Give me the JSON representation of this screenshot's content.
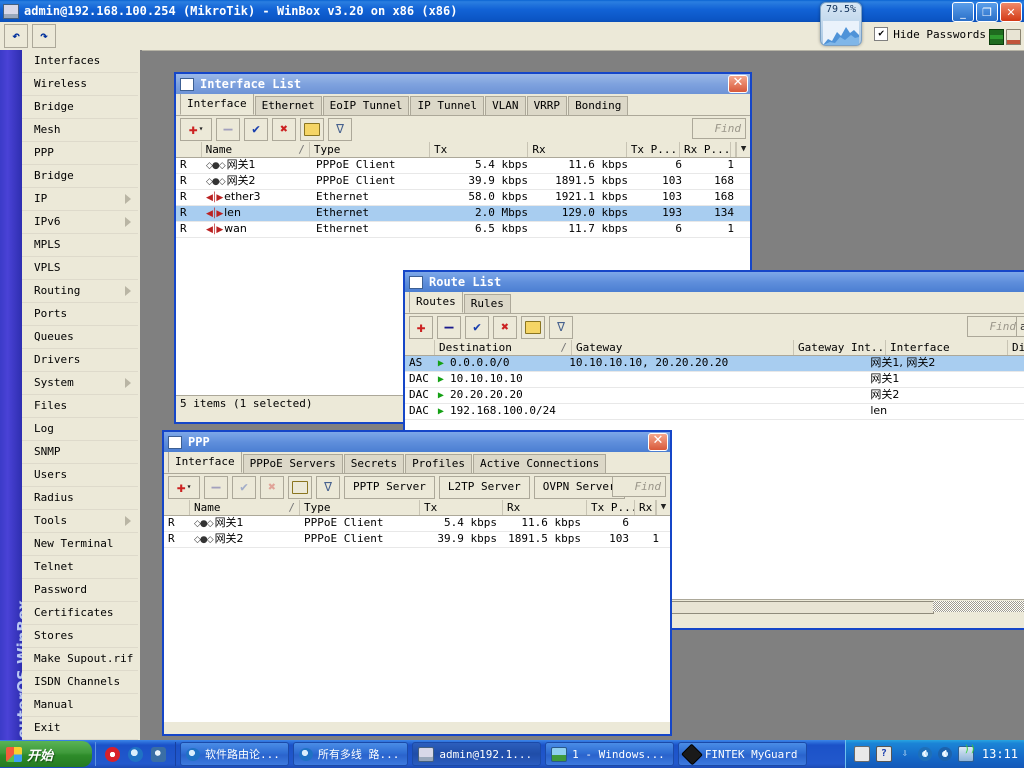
{
  "app": {
    "title": "admin@192.168.100.254 (MikroTik) - WinBox v3.20 on x86 (x86)",
    "title_icon": "window-icon",
    "minimize_label": "_",
    "maximize_label": "❐",
    "close_label": "✕",
    "toolbar": {
      "undo_icon": "↶",
      "redo_icon": "↷",
      "hide_passwords_label": "Hide Passwords",
      "hide_passwords_checked": "✔",
      "cpu_percent": "79.5%"
    }
  },
  "sidebar": {
    "rail_label": "RouterOS WinBox",
    "items": [
      {
        "label": "Interfaces",
        "submenu": false
      },
      {
        "label": "Wireless",
        "submenu": false
      },
      {
        "label": "Bridge",
        "submenu": false
      },
      {
        "label": "Mesh",
        "submenu": false
      },
      {
        "label": "PPP",
        "submenu": false
      },
      {
        "label": "Bridge",
        "submenu": false
      },
      {
        "label": "IP",
        "submenu": true
      },
      {
        "label": "IPv6",
        "submenu": true
      },
      {
        "label": "MPLS",
        "submenu": false
      },
      {
        "label": "VPLS",
        "submenu": false
      },
      {
        "label": "Routing",
        "submenu": true
      },
      {
        "label": "Ports",
        "submenu": false
      },
      {
        "label": "Queues",
        "submenu": false
      },
      {
        "label": "Drivers",
        "submenu": false
      },
      {
        "label": "System",
        "submenu": true
      },
      {
        "label": "Files",
        "submenu": false
      },
      {
        "label": "Log",
        "submenu": false
      },
      {
        "label": "SNMP",
        "submenu": false
      },
      {
        "label": "Users",
        "submenu": false
      },
      {
        "label": "Radius",
        "submenu": false
      },
      {
        "label": "Tools",
        "submenu": true
      },
      {
        "label": "New Terminal",
        "submenu": false
      },
      {
        "label": "Telnet",
        "submenu": false
      },
      {
        "label": "Password",
        "submenu": false
      },
      {
        "label": "Certificates",
        "submenu": false
      },
      {
        "label": "Stores",
        "submenu": false
      },
      {
        "label": "Make Supout.rif",
        "submenu": false
      },
      {
        "label": "ISDN Channels",
        "submenu": false
      },
      {
        "label": "Manual",
        "submenu": false
      },
      {
        "label": "Exit",
        "submenu": false
      }
    ]
  },
  "interface_window": {
    "title": "Interface List",
    "close_label": "✕",
    "tabs": [
      "Interface",
      "Ethernet",
      "EoIP Tunnel",
      "IP Tunnel",
      "VLAN",
      "VRRP",
      "Bonding"
    ],
    "active_tab": "Interface",
    "toolbar": {
      "add_label": "✚",
      "add_arrow": "▾",
      "remove_label": "—",
      "enable_label": "✔",
      "disable_label": "✖",
      "comment_label": "folder-icon",
      "filter_label": "∇",
      "find_placeholder": "Find"
    },
    "columns": [
      "",
      "Name",
      "Type",
      "Tx",
      "Rx",
      "Tx P...",
      "Rx P..."
    ],
    "sort_column": "Name",
    "rows": [
      {
        "flags": "R",
        "icon": "pppoe",
        "name": "网关1",
        "type": "PPPoE Client",
        "tx": "5.4 kbps",
        "rx": "11.6 kbps",
        "txp": "6",
        "rxp": "1",
        "selected": false
      },
      {
        "flags": "R",
        "icon": "pppoe",
        "name": "网关2",
        "type": "PPPoE Client",
        "tx": "39.9 kbps",
        "rx": "1891.5 kbps",
        "txp": "103",
        "rxp": "168",
        "selected": false
      },
      {
        "flags": "R",
        "icon": "eth",
        "name": "ether3",
        "type": "Ethernet",
        "tx": "58.0 kbps",
        "rx": "1921.1 kbps",
        "txp": "103",
        "rxp": "168",
        "selected": false
      },
      {
        "flags": "R",
        "icon": "eth",
        "name": "len",
        "type": "Ethernet",
        "tx": "2.0 Mbps",
        "rx": "129.0 kbps",
        "txp": "193",
        "rxp": "134",
        "selected": true
      },
      {
        "flags": "R",
        "icon": "eth",
        "name": "wan",
        "type": "Ethernet",
        "tx": "6.5 kbps",
        "rx": "11.7 kbps",
        "txp": "6",
        "rxp": "1",
        "selected": false
      }
    ],
    "status": "5 items (1 selected)"
  },
  "route_window": {
    "title": "Route List",
    "tabs": [
      "Routes",
      "Rules"
    ],
    "active_tab": "Routes",
    "toolbar": {
      "add_label": "✚",
      "remove_label": "—",
      "enable_label": "✔",
      "disable_label": "✖",
      "comment_label": "folder-icon",
      "filter_label": "∇",
      "find_placeholder": "Find",
      "scope_label": "a"
    },
    "columns": [
      "",
      "Destination",
      "Gateway",
      "Gateway Int...",
      "Interface",
      "Dist"
    ],
    "sort_column": "Destination",
    "rows": [
      {
        "flags": "AS",
        "destination": "0.0.0.0/0",
        "gateway": "10.10.10.10, 20.20.20.20",
        "gateway_int": "",
        "interface": "网关1, 网关2",
        "dist": "",
        "selected": true
      },
      {
        "flags": "DAC",
        "destination": "10.10.10.10",
        "gateway": "",
        "gateway_int": "",
        "interface": "网关1",
        "dist": "",
        "selected": false
      },
      {
        "flags": "DAC",
        "destination": "20.20.20.20",
        "gateway": "",
        "gateway_int": "",
        "interface": "网关2",
        "dist": "",
        "selected": false
      },
      {
        "flags": "DAC",
        "destination": "192.168.100.0/24",
        "gateway": "",
        "gateway_int": "",
        "interface": "len",
        "dist": "",
        "selected": false
      }
    ]
  },
  "ppp_window": {
    "title": "PPP",
    "close_label": "✕",
    "tabs": [
      "Interface",
      "PPPoE Servers",
      "Secrets",
      "Profiles",
      "Active Connections"
    ],
    "active_tab": "Interface",
    "toolbar": {
      "add_label": "✚",
      "add_arrow": "▾",
      "remove_label": "—",
      "enable_label": "✔",
      "disable_label": "✖",
      "comment_label": "folder-icon",
      "filter_label": "∇",
      "pptp_server_label": "PPTP Server",
      "l2tp_server_label": "L2TP Server",
      "ovpn_server_label": "OVPN Server",
      "find_placeholder": "Find"
    },
    "columns": [
      "",
      "Name",
      "Type",
      "Tx",
      "Rx",
      "Tx P...",
      "Rx"
    ],
    "sort_column": "Name",
    "rows": [
      {
        "flags": "R",
        "icon": "pppoe",
        "name": "网关1",
        "type": "PPPoE Client",
        "tx": "5.4 kbps",
        "rx": "11.6 kbps",
        "txp": "6",
        "rxp": ""
      },
      {
        "flags": "R",
        "icon": "pppoe",
        "name": "网关2",
        "type": "PPPoE Client",
        "tx": "39.9 kbps",
        "rx": "1891.5 kbps",
        "txp": "103",
        "rxp": "1"
      }
    ]
  },
  "taskbar": {
    "start_label": "开始",
    "quick_launch": [
      "opera-icon",
      "ie-icon",
      "media-icon"
    ],
    "buttons": [
      {
        "label": "软件路由论...",
        "icon": "ie-icon",
        "active": false
      },
      {
        "label": "所有多线 路...",
        "icon": "ie-icon",
        "active": false
      },
      {
        "label": "admin@192.1...",
        "icon": "winbox-icon",
        "active": true
      },
      {
        "label": "1 - Windows...",
        "icon": "image-icon",
        "active": false
      },
      {
        "label": "FINTEK MyGuard",
        "icon": "chip-icon",
        "active": false
      }
    ],
    "tray_icons": [
      "keyboard-icon",
      "help-icon",
      "updates-icon",
      "shield-icon",
      "network-icon",
      "volume-icon"
    ],
    "clock": "13:11"
  }
}
